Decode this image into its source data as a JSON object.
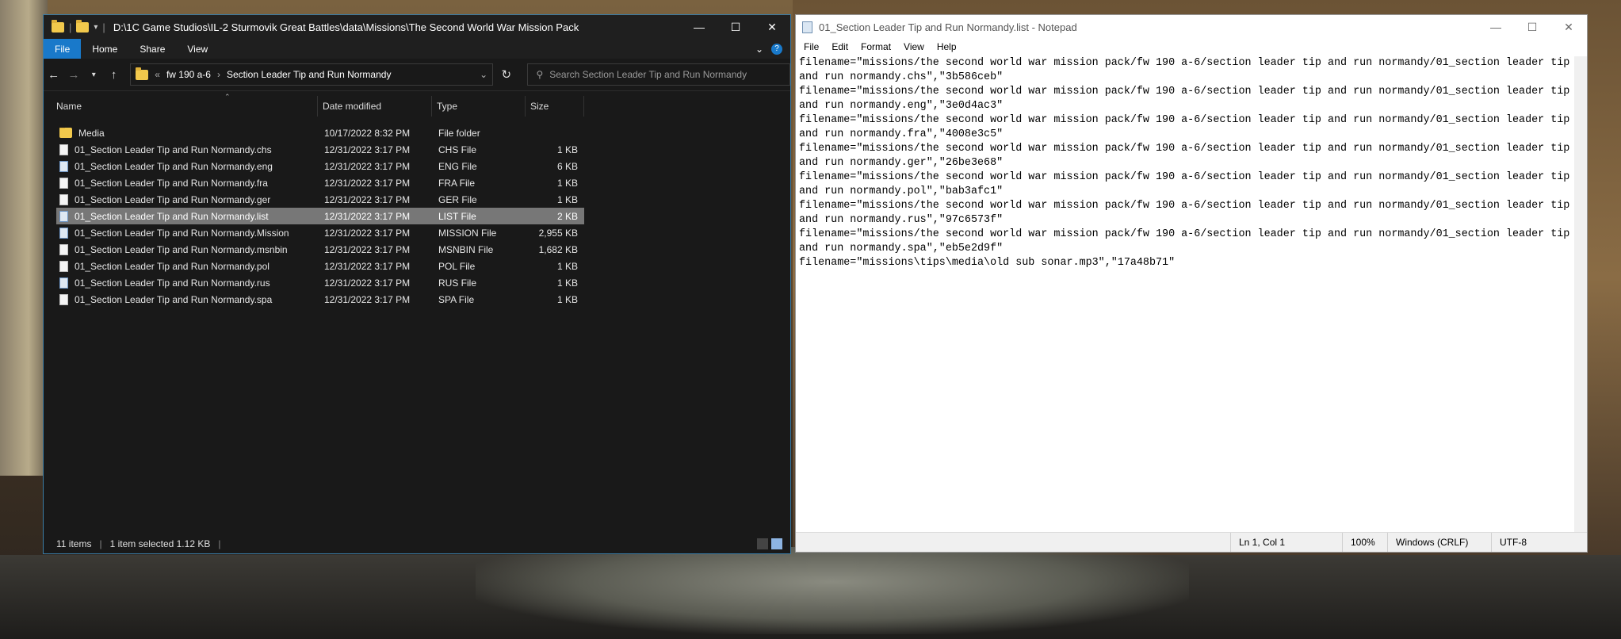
{
  "explorer": {
    "title_path": "D:\\1C Game Studios\\IL-2 Sturmovik Great Battles\\data\\Missions\\The Second World War Mission Pack",
    "ribbon_tabs": [
      "File",
      "Home",
      "Share",
      "View"
    ],
    "address": {
      "overflow": "«",
      "crumbs": [
        "fw 190 a-6",
        "Section Leader Tip and Run Normandy"
      ]
    },
    "search_placeholder": "Search Section Leader Tip and Run Normandy",
    "columns": {
      "name": "Name",
      "date": "Date modified",
      "type": "Type",
      "size": "Size"
    },
    "files": [
      {
        "name": "Media",
        "date": "10/17/2022 8:32 PM",
        "type": "File folder",
        "size": "",
        "icon": "folder-icon"
      },
      {
        "name": "01_Section Leader Tip and Run Normandy.chs",
        "date": "12/31/2022 3:17 PM",
        "type": "CHS File",
        "size": "1 KB",
        "icon": "file-icon"
      },
      {
        "name": "01_Section Leader Tip and Run Normandy.eng",
        "date": "12/31/2022 3:17 PM",
        "type": "ENG File",
        "size": "6 KB",
        "icon": "file-image-icon"
      },
      {
        "name": "01_Section Leader Tip and Run Normandy.fra",
        "date": "12/31/2022 3:17 PM",
        "type": "FRA File",
        "size": "1 KB",
        "icon": "file-icon"
      },
      {
        "name": "01_Section Leader Tip and Run Normandy.ger",
        "date": "12/31/2022 3:17 PM",
        "type": "GER File",
        "size": "1 KB",
        "icon": "file-icon"
      },
      {
        "name": "01_Section Leader Tip and Run Normandy.list",
        "date": "12/31/2022 3:17 PM",
        "type": "LIST File",
        "size": "2 KB",
        "icon": "file-image-icon",
        "selected": true
      },
      {
        "name": "01_Section Leader Tip and Run Normandy.Mission",
        "date": "12/31/2022 3:17 PM",
        "type": "MISSION File",
        "size": "2,955 KB",
        "icon": "file-image-icon"
      },
      {
        "name": "01_Section Leader Tip and Run Normandy.msnbin",
        "date": "12/31/2022 3:17 PM",
        "type": "MSNBIN File",
        "size": "1,682 KB",
        "icon": "file-icon"
      },
      {
        "name": "01_Section Leader Tip and Run Normandy.pol",
        "date": "12/31/2022 3:17 PM",
        "type": "POL File",
        "size": "1 KB",
        "icon": "file-icon"
      },
      {
        "name": "01_Section Leader Tip and Run Normandy.rus",
        "date": "12/31/2022 3:17 PM",
        "type": "RUS File",
        "size": "1 KB",
        "icon": "file-image-icon"
      },
      {
        "name": "01_Section Leader Tip and Run Normandy.spa",
        "date": "12/31/2022 3:17 PM",
        "type": "SPA File",
        "size": "1 KB",
        "icon": "file-icon"
      }
    ],
    "status": {
      "items": "11 items",
      "selected": "1 item selected  1.12 KB"
    }
  },
  "notepad": {
    "title": "01_Section Leader Tip and Run Normandy.list - Notepad",
    "menu": [
      "File",
      "Edit",
      "Format",
      "View",
      "Help"
    ],
    "content": "filename=\"missions/the second world war mission pack/fw 190 a-6/section leader tip and run normandy/01_section leader tip and run normandy.chs\",\"3b586ceb\"\nfilename=\"missions/the second world war mission pack/fw 190 a-6/section leader tip and run normandy/01_section leader tip and run normandy.eng\",\"3e0d4ac3\"\nfilename=\"missions/the second world war mission pack/fw 190 a-6/section leader tip and run normandy/01_section leader tip and run normandy.fra\",\"4008e3c5\"\nfilename=\"missions/the second world war mission pack/fw 190 a-6/section leader tip and run normandy/01_section leader tip and run normandy.ger\",\"26be3e68\"\nfilename=\"missions/the second world war mission pack/fw 190 a-6/section leader tip and run normandy/01_section leader tip and run normandy.pol\",\"bab3afc1\"\nfilename=\"missions/the second world war mission pack/fw 190 a-6/section leader tip and run normandy/01_section leader tip and run normandy.rus\",\"97c6573f\"\nfilename=\"missions/the second world war mission pack/fw 190 a-6/section leader tip and run normandy/01_section leader tip and run normandy.spa\",\"eb5e2d9f\"\nfilename=\"missions\\tips\\media\\old sub sonar.mp3\",\"17a48b71\"",
    "status": {
      "position": "Ln 1, Col 1",
      "zoom": "100%",
      "eol": "Windows (CRLF)",
      "encoding": "UTF-8"
    }
  },
  "colors": {
    "accent": "#1979ca",
    "selected_row": "#777777"
  }
}
